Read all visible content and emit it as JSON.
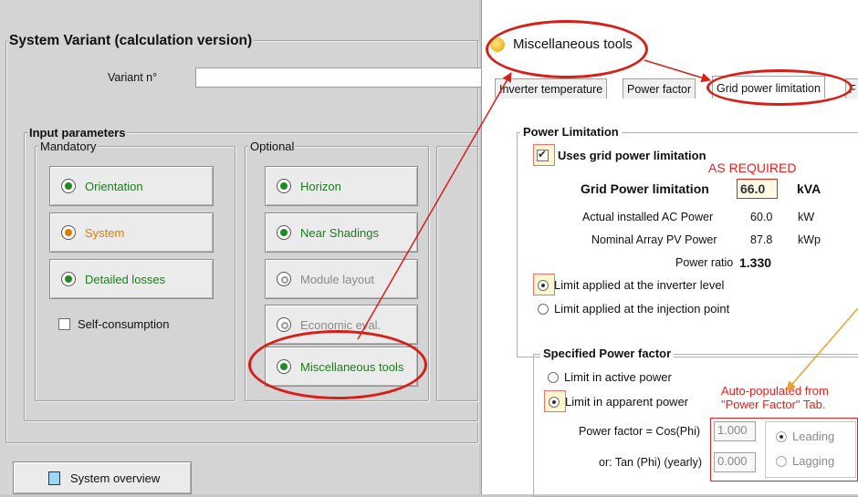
{
  "left": {
    "section_title": "System Variant (calculation version)",
    "variant_label": "Variant n°",
    "variant_value": "",
    "input_parameters_title": "Input parameters",
    "mandatory_title": "Mandatory",
    "optional_title": "Optional",
    "mandatory_buttons": [
      {
        "label": "Orientation",
        "led": "green",
        "text_color": "green"
      },
      {
        "label": "System",
        "led": "orange",
        "text_color": "orange"
      },
      {
        "label": "Detailed losses",
        "led": "green",
        "text_color": "green"
      }
    ],
    "self_consumption_label": "Self-consumption",
    "self_consumption_checked": false,
    "optional_buttons": [
      {
        "label": "Horizon",
        "led": "green",
        "text_color": "green"
      },
      {
        "label": "Near Shadings",
        "led": "green",
        "text_color": "green"
      },
      {
        "label": "Module layout",
        "led": "hollow",
        "text_color": "gray"
      },
      {
        "label": "Economic eval.",
        "led": "hollow",
        "text_color": "gray"
      },
      {
        "label": "Miscellaneous tools",
        "led": "green",
        "text_color": "green"
      }
    ],
    "system_overview_label": "System overview"
  },
  "right": {
    "window_title": "Miscellaneous tools",
    "tabs": [
      {
        "label": "Inverter temperature",
        "active": false
      },
      {
        "label": "Power factor",
        "active": false
      },
      {
        "label": "Grid power limitation",
        "active": true
      },
      {
        "label": "F",
        "active": false
      }
    ],
    "power_limitation": {
      "title": "Power Limitation",
      "uses_label": "Uses grid power limitation",
      "uses_checked": true,
      "grid_label": "Grid Power limitation",
      "grid_value": "66.0",
      "grid_unit": "kVA",
      "ac_label": "Actual installed AC Power",
      "ac_value": "60.0",
      "ac_unit": "kW",
      "pv_label": "Nominal Array PV Power",
      "pv_value": "87.8",
      "pv_unit": "kWp",
      "ratio_label": "Power ratio",
      "ratio_value": "1.330",
      "radio_inverter": "Limit applied at the inverter level",
      "radio_injection": "Limit applied at the injection point",
      "selected": "inverter"
    },
    "power_factor": {
      "title": "Specified Power factor",
      "radio_active": "Limit in active power",
      "radio_apparent": "Limit in apparent power",
      "selected": "apparent",
      "cos_label": "Power factor = Cos(Phi)",
      "cos_value": "1.000",
      "tan_label": "or:  Tan (Phi)  (yearly)",
      "tan_value": "0.000",
      "leading_label": "Leading",
      "lagging_label": "Lagging",
      "phase_selected": "leading"
    },
    "annotations": {
      "as_required": "AS REQUIRED",
      "auto_populated_line1": "Auto-populated from",
      "auto_populated_line2": "\"Power Factor\" Tab."
    }
  },
  "colors": {
    "annotation_red": "#d91e18",
    "annotation_orange": "#f0a030",
    "led_green": "#1e8c1e",
    "led_orange": "#e07b00"
  }
}
